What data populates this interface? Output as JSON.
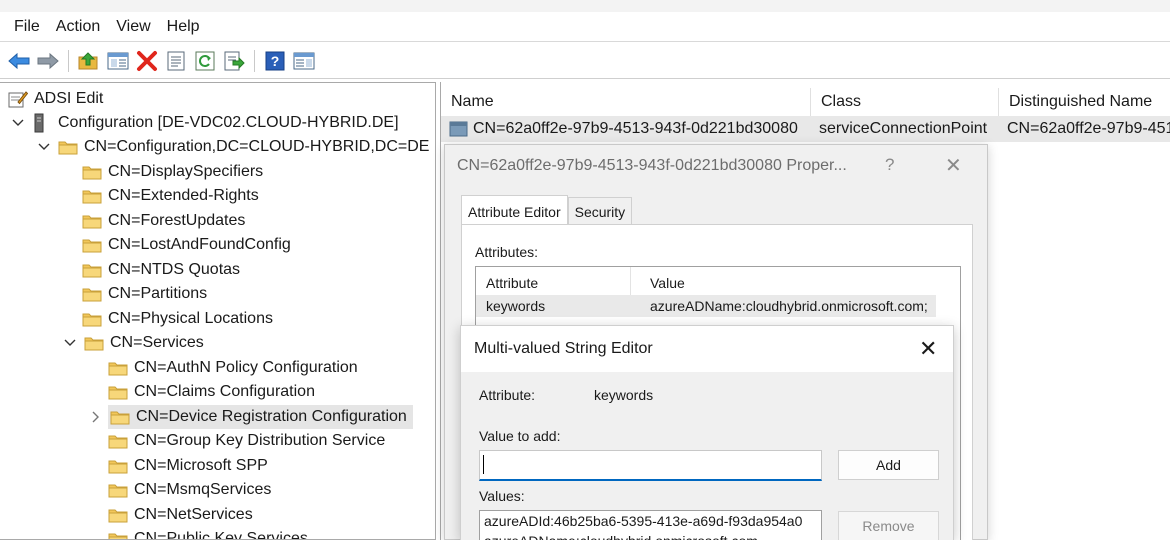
{
  "menu": {
    "items": [
      "File",
      "Action",
      "View",
      "Help"
    ]
  },
  "toolbar": {
    "buttons": [
      "back-arrow-icon",
      "forward-arrow-icon",
      "up-folder-icon",
      "show-hide-tree-icon",
      "delete-icon",
      "properties-icon",
      "refresh-icon",
      "export-list-icon",
      "help-icon",
      "action-pane-icon"
    ]
  },
  "tree": {
    "items": [
      {
        "label": "ADSI Edit",
        "icon": "adsi-edit-icon",
        "expander": ""
      },
      {
        "label": "Configuration [DE-VDC02.CLOUD-HYBRID.DE]",
        "icon": "server-icon",
        "expander": "expanded"
      },
      {
        "label": "CN=Configuration,DC=CLOUD-HYBRID,DC=DE",
        "icon": "folder-icon",
        "expander": "expanded"
      },
      {
        "label": "CN=DisplaySpecifiers",
        "icon": "folder-icon",
        "expander": ""
      },
      {
        "label": "CN=Extended-Rights",
        "icon": "folder-icon",
        "expander": ""
      },
      {
        "label": "CN=ForestUpdates",
        "icon": "folder-icon",
        "expander": ""
      },
      {
        "label": "CN=LostAndFoundConfig",
        "icon": "folder-icon",
        "expander": ""
      },
      {
        "label": "CN=NTDS Quotas",
        "icon": "folder-icon",
        "expander": ""
      },
      {
        "label": "CN=Partitions",
        "icon": "folder-icon",
        "expander": ""
      },
      {
        "label": "CN=Physical Locations",
        "icon": "folder-icon",
        "expander": ""
      },
      {
        "label": "CN=Services",
        "icon": "folder-icon",
        "expander": "expanded"
      },
      {
        "label": "CN=AuthN Policy Configuration",
        "icon": "folder-icon",
        "expander": ""
      },
      {
        "label": "CN=Claims Configuration",
        "icon": "folder-icon",
        "expander": ""
      },
      {
        "label": "CN=Device Registration Configuration",
        "icon": "folder-icon",
        "expander": "collapsed",
        "selected": true
      },
      {
        "label": "CN=Group Key Distribution Service",
        "icon": "folder-icon",
        "expander": ""
      },
      {
        "label": "CN=Microsoft SPP",
        "icon": "folder-icon",
        "expander": ""
      },
      {
        "label": "CN=MsmqServices",
        "icon": "folder-icon",
        "expander": ""
      },
      {
        "label": "CN=NetServices",
        "icon": "folder-icon",
        "expander": ""
      },
      {
        "label": "CN=Public Key Services",
        "icon": "folder-icon",
        "expander": ""
      }
    ]
  },
  "list": {
    "columns": [
      "Name",
      "Class",
      "Distinguished Name"
    ],
    "rows": [
      {
        "name": "CN=62a0ff2e-97b9-4513-943f-0d221bd30080",
        "class": "serviceConnectionPoint",
        "dn": "CN=62a0ff2e-97b9-451"
      }
    ]
  },
  "props": {
    "title": "CN=62a0ff2e-97b9-4513-943f-0d221bd30080 Proper...",
    "help": "?",
    "close": "✕",
    "tabs": [
      "Attribute Editor",
      "Security"
    ],
    "attributes_label": "Attributes:",
    "table_headers": [
      "Attribute",
      "Value"
    ],
    "rows": [
      {
        "attribute": "keywords",
        "value": "azureADName:cloudhybrid.onmicrosoft.com;"
      }
    ]
  },
  "mv_editor": {
    "title": "Multi-valued String Editor",
    "close": "✕",
    "attribute_label": "Attribute:",
    "attribute_value": "keywords",
    "value_to_add_label": "Value to add:",
    "input_value": "",
    "add_label": "Add",
    "values_label": "Values:",
    "values": [
      "azureADId:46b25ba6-5395-413e-a69d-f93da954a0",
      "azureADName:cloudhybrid.onmicrosoft.com"
    ],
    "remove_label": "Remove"
  },
  "colors": {
    "accent": "#0067c0",
    "folder": "#f2c75a",
    "selection": "#e5e5e5"
  }
}
